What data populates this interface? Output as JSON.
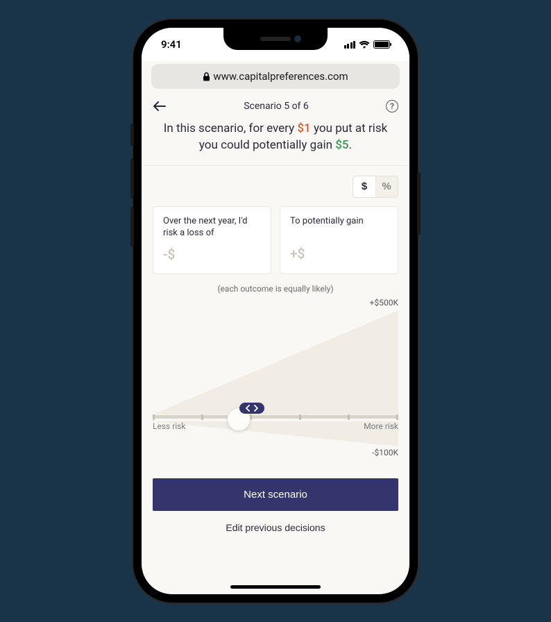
{
  "status": {
    "time": "9:41"
  },
  "browser": {
    "url": "www.capitalpreferences.com"
  },
  "header": {
    "scenario_label": "Scenario 5 of 6",
    "headline_pre": "In this scenario, for every ",
    "headline_risk": "$1",
    "headline_mid": " you put at risk you could potentially gain ",
    "headline_gain": "$5",
    "headline_post": "."
  },
  "toggle": {
    "dollar": "$",
    "percent": "%"
  },
  "cards": {
    "loss_label": "Over the next year, I'd risk a loss of",
    "loss_value": "-$",
    "gain_label": "To potentially gain",
    "gain_value": "+$"
  },
  "note": "(each outcome is equally likely)",
  "chart": {
    "gain_max": "+$500K",
    "loss_max": "-$100K",
    "less_risk": "Less risk",
    "more_risk": "More risk"
  },
  "chart_data": {
    "type": "area",
    "gain_max": 500000,
    "loss_max": -100000,
    "slider_position_pct": 35,
    "slider_steps": 6,
    "upper_polygon": [
      [
        0,
        100
      ],
      [
        100,
        0
      ],
      [
        100,
        100
      ]
    ],
    "lower_polygon": [
      [
        0,
        0
      ],
      [
        100,
        100
      ],
      [
        100,
        0
      ]
    ]
  },
  "actions": {
    "next": "Next scenario",
    "edit": "Edit previous decisions"
  }
}
